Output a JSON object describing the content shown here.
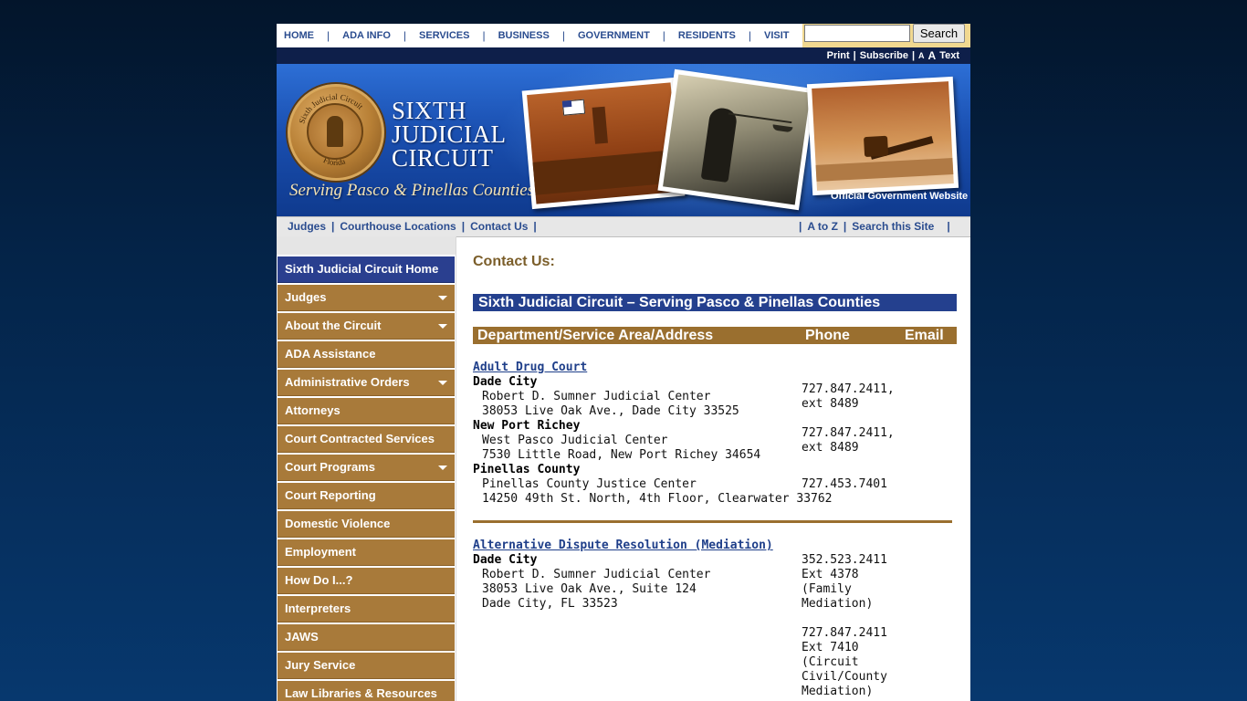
{
  "topnav": {
    "items": [
      "HOME",
      "ADA INFO",
      "SERVICES",
      "BUSINESS",
      "GOVERNMENT",
      "RESIDENTS",
      "VISIT"
    ],
    "search": {
      "value": "",
      "button": "Search"
    }
  },
  "utility": {
    "print": "Print",
    "subscribe": "Subscribe",
    "small_a": "A",
    "big_a": "A",
    "text": "Text"
  },
  "banner": {
    "title_lines": [
      "SIXTH",
      "JUDICIAL",
      "CIRCUIT"
    ],
    "tagline": "Serving Pasco & Pinellas Counties",
    "official": "Official Government Website",
    "seal_text_top": "Sixth Judicial Circuit",
    "seal_text_bottom": "Florida"
  },
  "subnav": {
    "left": [
      "Judges",
      "Courthouse Locations",
      "Contact Us"
    ],
    "right": [
      "A to Z",
      "Search this Site"
    ]
  },
  "sidebar": {
    "items": [
      {
        "label": "Sixth Judicial Circuit Home",
        "active": true,
        "caret": false
      },
      {
        "label": "Judges",
        "active": false,
        "caret": true
      },
      {
        "label": "About the Circuit",
        "active": false,
        "caret": true
      },
      {
        "label": "ADA Assistance",
        "active": false,
        "caret": false
      },
      {
        "label": "Administrative Orders",
        "active": false,
        "caret": true
      },
      {
        "label": "Attorneys",
        "active": false,
        "caret": false
      },
      {
        "label": "Court Contracted Services",
        "active": false,
        "caret": false
      },
      {
        "label": "Court Programs",
        "active": false,
        "caret": true
      },
      {
        "label": "Court Reporting",
        "active": false,
        "caret": false
      },
      {
        "label": "Domestic Violence",
        "active": false,
        "caret": false
      },
      {
        "label": "Employment",
        "active": false,
        "caret": false
      },
      {
        "label": "How Do I...?",
        "active": false,
        "caret": false
      },
      {
        "label": "Interpreters",
        "active": false,
        "caret": false
      },
      {
        "label": "JAWS",
        "active": false,
        "caret": false
      },
      {
        "label": "Jury Service",
        "active": false,
        "caret": false
      },
      {
        "label": "Law Libraries & Resources",
        "active": false,
        "caret": false
      }
    ]
  },
  "main": {
    "heading": "Contact Us:",
    "circuit_bar": "Sixth Judicial Circuit – Serving Pasco & Pinellas Counties",
    "columns": [
      "Department/Service Area/Address",
      "Phone",
      "Email"
    ],
    "entries": [
      {
        "title": "Adult Drug Court",
        "locations": [
          {
            "name": "Dade City",
            "address": "Robert D. Sumner Judicial Center\n38053 Live Oak Ave., Dade City 33525",
            "phone": "727.847.2411,\next 8489"
          },
          {
            "name": "New Port Richey",
            "address": "West Pasco Judicial Center\n7530 Little Road, New Port Richey 34654",
            "phone": "727.847.2411,\next 8489"
          },
          {
            "name": "Pinellas County",
            "address": "Pinellas County Justice Center\n14250 49th St. North, 4th Floor, Clearwater 33762",
            "phone": "727.453.7401"
          }
        ]
      },
      {
        "title": "Alternative Dispute Resolution (Mediation)",
        "locations": [
          {
            "name": "Dade City",
            "address": "Robert D. Sumner Judicial Center\n38053 Live Oak Ave., Suite 124\nDade City, FL 33523",
            "phone": "352.523.2411\nExt 4378\n(Family\nMediation)\n\n727.847.2411\nExt 7410\n(Circuit\nCivil/County\nMediation)"
          }
        ]
      }
    ]
  }
}
